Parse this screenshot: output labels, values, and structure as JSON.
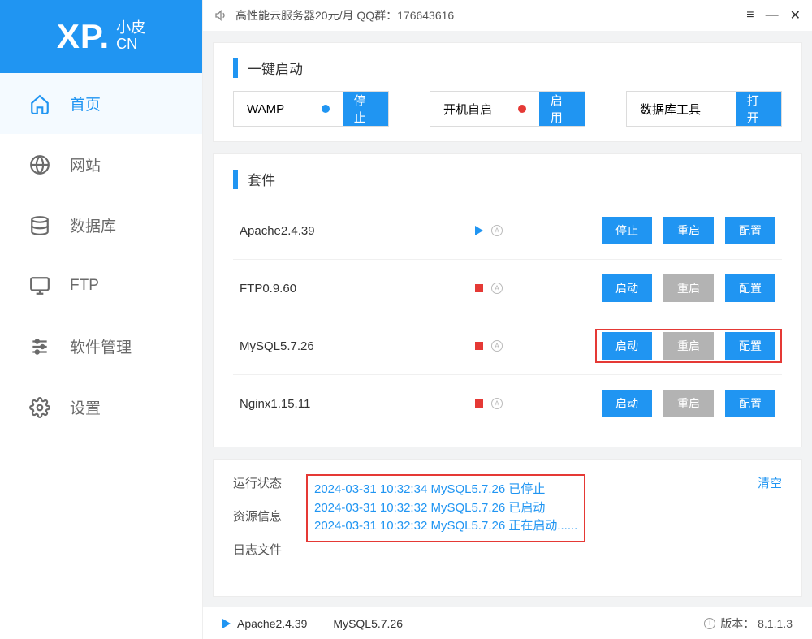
{
  "topbar": {
    "announce": "高性能云服务器20元/月  QQ群：176643616"
  },
  "logo": {
    "main": "XP.",
    "sub_top": "小皮",
    "sub_bottom": "CN"
  },
  "nav": [
    {
      "label": "首页",
      "icon": "home-icon",
      "active": true
    },
    {
      "label": "网站",
      "icon": "globe-icon",
      "active": false
    },
    {
      "label": "数据库",
      "icon": "database-icon",
      "active": false
    },
    {
      "label": "FTP",
      "icon": "monitor-icon",
      "active": false
    },
    {
      "label": "软件管理",
      "icon": "sliders-icon",
      "active": false
    },
    {
      "label": "设置",
      "icon": "gear-icon",
      "active": false
    }
  ],
  "quick": {
    "title": "一键启动",
    "items": [
      {
        "label": "WAMP",
        "dot": "blue",
        "btn": "停止"
      },
      {
        "label": "开机自启",
        "dot": "red",
        "btn": "启用"
      },
      {
        "label": "数据库工具",
        "dot": "",
        "btn": "打开"
      }
    ]
  },
  "suite": {
    "title": "套件",
    "btn_stop": "停止",
    "btn_start": "启动",
    "btn_restart": "重启",
    "btn_config": "配置",
    "services": [
      {
        "name": "Apache2.4.39",
        "running": true,
        "highlight": false,
        "start_label": "停止",
        "restart_enabled": true
      },
      {
        "name": "FTP0.9.60",
        "running": false,
        "highlight": false,
        "start_label": "启动",
        "restart_enabled": false
      },
      {
        "name": "MySQL5.7.26",
        "running": false,
        "highlight": true,
        "start_label": "启动",
        "restart_enabled": false
      },
      {
        "name": "Nginx1.15.11",
        "running": false,
        "highlight": false,
        "start_label": "启动",
        "restart_enabled": false
      }
    ]
  },
  "log": {
    "labels": {
      "status": "运行状态",
      "resource": "资源信息",
      "logfile": "日志文件"
    },
    "clear": "清空",
    "lines": [
      "2024-03-31 10:32:34 MySQL5.7.26 已停止",
      "2024-03-31 10:32:32 MySQL5.7.26 已启动",
      "2024-03-31 10:32:32 MySQL5.7.26 正在启动......"
    ]
  },
  "status": {
    "items": [
      {
        "name": "Apache2.4.39",
        "running": true
      },
      {
        "name": "MySQL5.7.26",
        "running": false
      }
    ],
    "version_label": "版本：",
    "version": "8.1.1.3"
  }
}
